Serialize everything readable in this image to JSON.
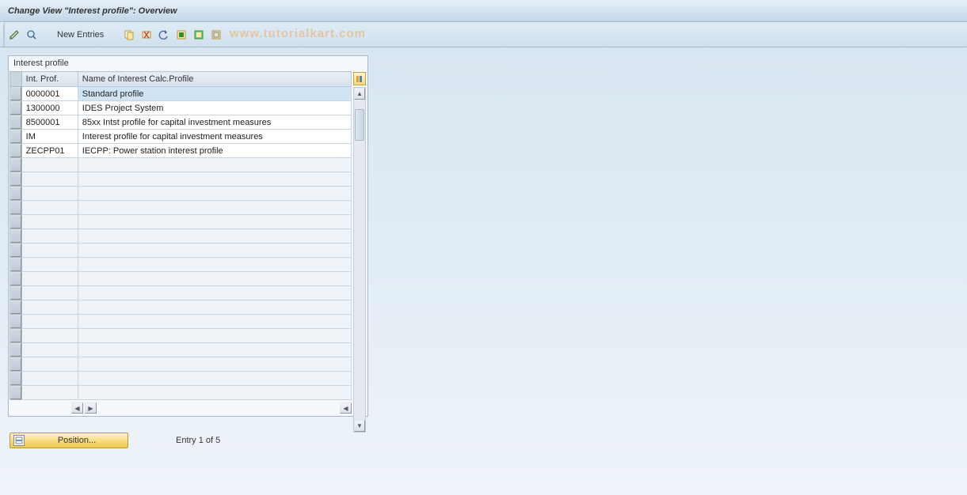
{
  "title": "Change View \"Interest profile\": Overview",
  "toolbar": {
    "new_entries": "New Entries"
  },
  "watermark": "www.tutorialkart.com",
  "group": {
    "title": "Interest profile",
    "columns": {
      "id": "Int. Prof.",
      "name": "Name of Interest Calc.Profile"
    },
    "rows": [
      {
        "id": "0000001",
        "name": "Standard profile",
        "selected": true
      },
      {
        "id": "1300000",
        "name": "IDES Project System",
        "selected": false
      },
      {
        "id": "8500001",
        "name": "85xx Intst profile for capital investment measures",
        "selected": false
      },
      {
        "id": "IM",
        "name": "Interest profile for capital investment measures",
        "selected": false
      },
      {
        "id": "ZECPP01",
        "name": "IECPP: Power station interest profile",
        "selected": false
      }
    ],
    "empty_rows": 17
  },
  "footer": {
    "position_label": "Position...",
    "entry_label": "Entry 1 of 5"
  }
}
